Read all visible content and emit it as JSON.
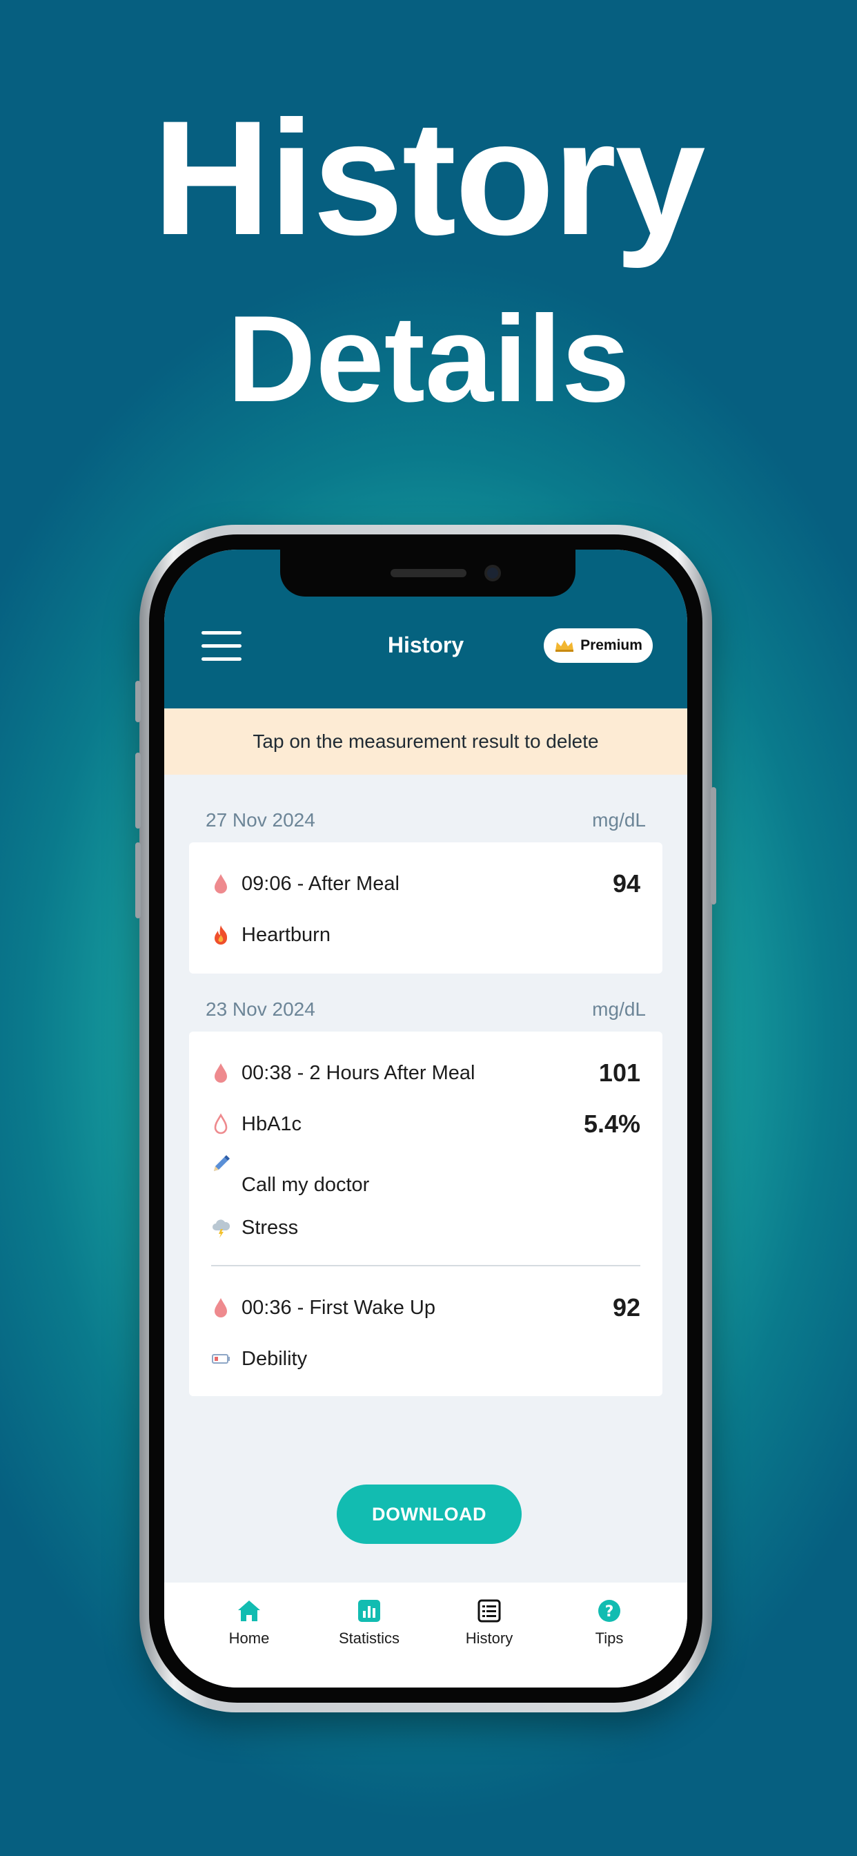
{
  "promo": {
    "line1": "History",
    "line2": "Details"
  },
  "header": {
    "menu_icon": "hamburger-icon",
    "title": "History",
    "premium_label": "Premium",
    "premium_icon": "crown-icon"
  },
  "notice": {
    "text": "Tap on the measurement result to delete"
  },
  "groups": [
    {
      "date": "27 Nov 2024",
      "unit": "mg/dL",
      "entries": [
        {
          "icon": "blood-drop-icon",
          "label": "09:06 - After Meal",
          "value": "94"
        },
        {
          "icon": "fire-icon",
          "label": "Heartburn"
        }
      ]
    },
    {
      "date": "23 Nov 2024",
      "unit": "mg/dL",
      "entries": [
        {
          "icon": "blood-drop-icon",
          "label": "00:38 - 2 Hours After Meal",
          "value": "101"
        },
        {
          "icon": "outline-drop-icon",
          "label": "HbA1c",
          "value": "5.4%"
        },
        {
          "icon": "pencil-icon",
          "label": "Call my doctor"
        },
        {
          "icon": "storm-cloud-icon",
          "label": "Stress"
        },
        {
          "icon": "blood-drop-icon",
          "label": "00:36 - First Wake Up",
          "value": "92"
        },
        {
          "icon": "battery-low-icon",
          "label": "Debility"
        }
      ]
    }
  ],
  "download": {
    "label": "DOWNLOAD"
  },
  "tabs": [
    {
      "label": "Home",
      "icon": "home-icon"
    },
    {
      "label": "Statistics",
      "icon": "bar-chart-icon"
    },
    {
      "label": "History",
      "icon": "list-icon"
    },
    {
      "label": "Tips",
      "icon": "question-icon"
    }
  ],
  "colors": {
    "accent": "#12bcb1",
    "header": "#05627f",
    "notice_bg": "#fdebd4",
    "drop": "#ee8a8e"
  }
}
